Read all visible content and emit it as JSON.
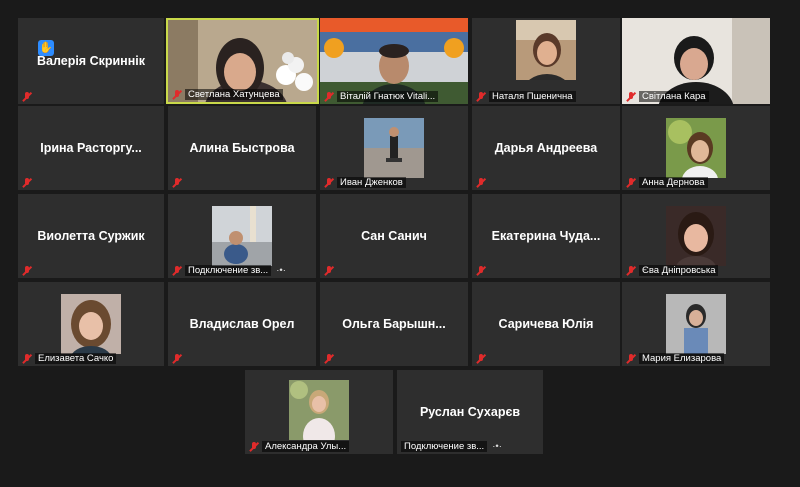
{
  "participants": {
    "r1": [
      "Валерія Скриннік",
      "Светлана Хатунцева",
      "Віталій Гнатюк Vitali...",
      "Наталя Пшенична",
      "Світлана Кара"
    ],
    "r2": [
      "Ірина  Расторгу...",
      "Алина Быстрова",
      "Иван Дженков",
      "Дарья Андреева",
      "Анна Дернова"
    ],
    "r3": [
      "Виолетта Суржик",
      "Подключение зв...",
      "Сан Санич",
      "Екатерина  Чуда...",
      "Єва Дніпровська"
    ],
    "r4": [
      "Елизавета Сачко",
      "Владислав Орел",
      "Ольга  Барышн...",
      "Саричева Юлія",
      "Мария Елизарова"
    ],
    "r5": [
      "Александра Улы...",
      "Руслан Сухарєв",
      "Подключение зв..."
    ]
  },
  "colors": {
    "active_border": "#c9d94a",
    "muted_mic": "#e02b2b",
    "tile_bg": "#2e2e2e",
    "raise_hand": "#2d8cff"
  },
  "icons": {
    "raised_hand": "raised-hand-icon",
    "muted_mic": "mic-muted-icon",
    "more": "more-dots"
  }
}
